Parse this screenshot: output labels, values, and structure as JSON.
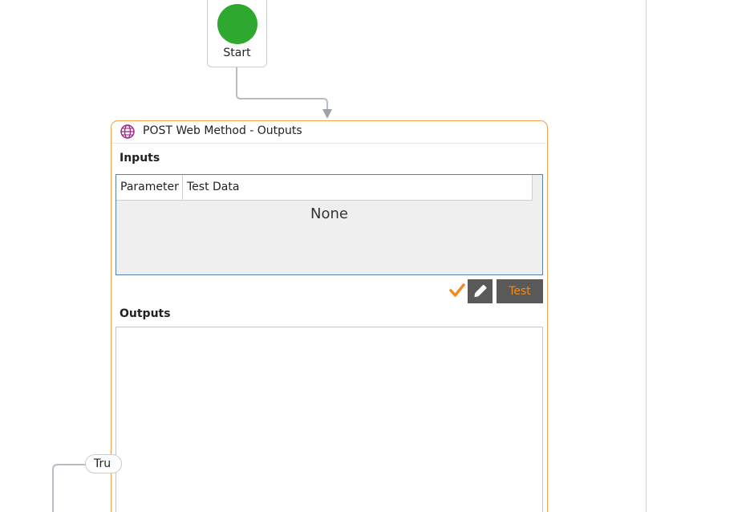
{
  "start_node": {
    "label": "Start"
  },
  "tool_node": {
    "title": "POST Web Method - Outputs",
    "icon": "globe-icon",
    "inputs": {
      "section_label": "Inputs",
      "columns": [
        "Parameter",
        "Test Data"
      ],
      "empty_text": "None"
    },
    "actions": {
      "check_icon": "check-icon",
      "edit_icon": "pencil-icon",
      "test_label": "Test"
    },
    "outputs": {
      "section_label": "Outputs"
    }
  },
  "branch_label": {
    "text": "Tru"
  },
  "colors": {
    "start_green": "#2ea82e",
    "node_border_orange": "#f0a04b",
    "accent_orange": "#f08a24",
    "button_dark": "#595959",
    "connector_gray": "#b8bcc4"
  }
}
